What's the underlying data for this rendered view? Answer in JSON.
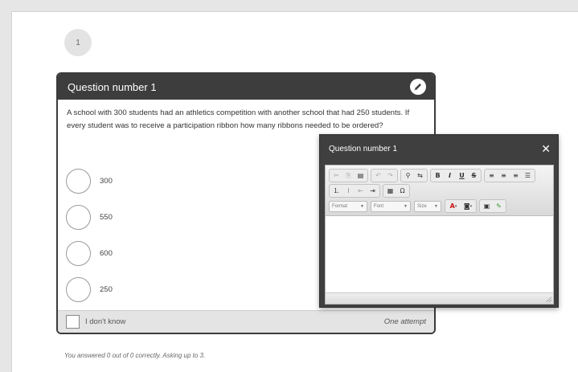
{
  "step": {
    "number": "1"
  },
  "question": {
    "title": "Question number 1",
    "text": "A school with 300 students had an athletics competition with another school that had 250 students. If every student was to receive a participation ribbon how many ribbons needed to be ordered?",
    "options": [
      "300",
      "550",
      "600",
      "250"
    ],
    "idk_label": "I don't know",
    "attempts_label": "One attempt",
    "edit_icon": "pencil-icon"
  },
  "summary": "You answered 0 out of 0 correctly. Asking up to 3.",
  "editor_dialog": {
    "title": "Question number 1",
    "close_symbol": "✕",
    "toolbar": {
      "row1": [
        [
          "cut-icon",
          "copy-icon",
          "paste-icon"
        ],
        [
          "undo-icon",
          "redo-icon"
        ],
        [
          "find-icon",
          "replace-icon"
        ],
        [
          "bold-icon",
          "italic-icon",
          "underline-icon",
          "strike-icon"
        ],
        [
          "align-left-icon",
          "align-center-icon",
          "align-right-icon",
          "justify-icon"
        ]
      ],
      "row2": [
        [
          "numbered-list-icon",
          "bullet-list-icon",
          "outdent-icon",
          "indent-icon"
        ],
        [
          "table-icon",
          "special-char-icon"
        ]
      ],
      "format_placeholder": "Format",
      "font_placeholder": "Font",
      "size_placeholder": "Size"
    }
  },
  "colors": {
    "header_dark": "#3d3d3d",
    "footer_gray": "#e4e4e4",
    "page_bg": "#e6e6e6"
  }
}
